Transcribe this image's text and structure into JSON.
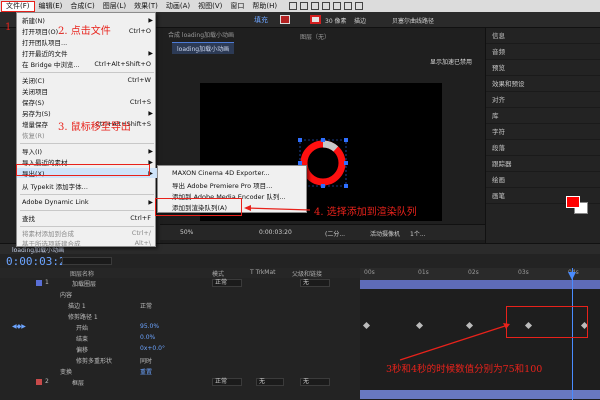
{
  "menubar": {
    "items": [
      "文件(F)",
      "编辑(E)",
      "合成(C)",
      "图层(L)",
      "效果(T)",
      "动画(A)",
      "视图(V)",
      "窗口",
      "帮助(H)"
    ]
  },
  "toolbar": {
    "fill_label": "填充",
    "stroke_width": "30 像素",
    "stroke_label": "描边",
    "bezier_label": "贝塞尔曲线路径",
    "fill_color": "#b32121",
    "stroke_color": "#d32020"
  },
  "file_menu": {
    "items": [
      {
        "label": "新建(N)",
        "shortcut": "",
        "submenu": true,
        "disabled": false
      },
      {
        "label": "打开项目(O)...",
        "shortcut": "Ctrl+O",
        "submenu": false,
        "disabled": false
      },
      {
        "label": "打开团队项目...",
        "shortcut": "",
        "submenu": false,
        "disabled": false
      },
      {
        "label": "打开最近的文件",
        "shortcut": "",
        "submenu": true,
        "disabled": false
      },
      {
        "label": "在 Bridge 中浏览...",
        "shortcut": "Ctrl+Alt+Shift+O",
        "submenu": false,
        "disabled": false
      },
      {
        "label": "关闭(C)",
        "shortcut": "Ctrl+W",
        "submenu": false,
        "disabled": false
      },
      {
        "label": "关闭项目",
        "shortcut": "",
        "submenu": false,
        "disabled": false
      },
      {
        "label": "保存(S)",
        "shortcut": "Ctrl+S",
        "submenu": false,
        "disabled": false
      },
      {
        "label": "另存为(S)",
        "shortcut": "",
        "submenu": true,
        "disabled": false
      },
      {
        "label": "增量保存",
        "shortcut": "Ctrl+Alt+Shift+S",
        "submenu": false,
        "disabled": false
      },
      {
        "label": "恢复(R)",
        "shortcut": "",
        "submenu": false,
        "disabled": true
      },
      {
        "label": "导入(I)",
        "shortcut": "",
        "submenu": true,
        "disabled": false
      },
      {
        "label": "导入最近的素材",
        "shortcut": "",
        "submenu": true,
        "disabled": false
      },
      {
        "label": "导出(X)",
        "shortcut": "",
        "submenu": true,
        "disabled": false
      },
      {
        "label": "从 Typekit 添加字体...",
        "shortcut": "",
        "submenu": false,
        "disabled": false
      },
      {
        "label": "Adobe Dynamic Link",
        "shortcut": "",
        "submenu": true,
        "disabled": false
      },
      {
        "label": "查找",
        "shortcut": "Ctrl+F",
        "submenu": false,
        "disabled": false
      },
      {
        "label": "将素材添加到合成",
        "shortcut": "Ctrl+/",
        "submenu": false,
        "disabled": true
      },
      {
        "label": "基于所选项新建合成",
        "shortcut": "Alt+\\",
        "submenu": false,
        "disabled": true
      }
    ]
  },
  "export_submenu": {
    "items": [
      "MAXON Cinema 4D Exporter...",
      "导出 Adobe Premiere Pro 项目...",
      "添加到 Adobe Media Encoder 队列...",
      "添加到渲染队列(A)"
    ]
  },
  "composition": {
    "panel_title": "合成 loading加载小动画",
    "tab_label": "loading加载小动画",
    "layer_panel": "图层（无）",
    "hint": "显示加速已禁用",
    "zoom": "50%",
    "time": "0:00:03:20",
    "resolution": "(二分...",
    "camera": "活动摄像机",
    "views": "1个..."
  },
  "right_panel": {
    "items": [
      "信息",
      "音频",
      "预览",
      "效果和预设",
      "对齐",
      "库",
      "字符",
      "段落",
      "跟踪器",
      "绘画",
      "画笔"
    ],
    "primary_color": "#ff0000",
    "secondary_color": "#ffffff"
  },
  "timeline": {
    "time": "0:00:03:20",
    "col_headers": {
      "name": "图层名称",
      "mode": "模式",
      "trkmat": "T  TrkMat",
      "parent": "父级和链接"
    },
    "rows": [
      {
        "num": "1",
        "name": "加载圈层",
        "mode": "正常",
        "parent": "无"
      },
      {
        "name": "内容"
      },
      {
        "name": "描边 1",
        "mode": "正常"
      },
      {
        "name": "修剪路径 1"
      },
      {
        "name": "开始",
        "value": "95.0%"
      },
      {
        "name": "结束",
        "value": "0.0%"
      },
      {
        "name": "偏移",
        "value": "0x+0.0°"
      },
      {
        "name": "修剪多重形状",
        "value": "同时"
      },
      {
        "name": "变换",
        "value": "重置"
      },
      {
        "num": "2",
        "name": "框层",
        "mode": "正常",
        "trkmat": "无",
        "parent": "无"
      }
    ],
    "ruler": [
      "00s",
      "01s",
      "02s",
      "03s",
      "04s"
    ]
  },
  "annotations": {
    "a1": "1",
    "a2": "2. 点击文件",
    "a3": "3. 鼠标移至导出",
    "a4": "4. 选择添加到渲染队列",
    "a5": "3秒和4秒的时候数值分别为75和100",
    "color": "#e8221b"
  }
}
